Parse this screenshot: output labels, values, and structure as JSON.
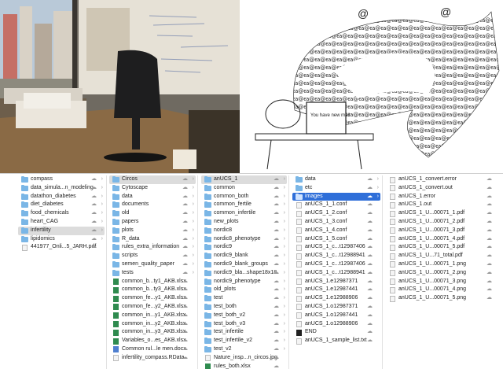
{
  "col1": [
    "compass",
    "data_simula...n_modeling",
    "datathon_diabetes",
    "diet_diabetes",
    "food_chemicals",
    "heart_CAG",
    "infertility",
    "lipidomics",
    "441977_Onli...5_JARH.pdf"
  ],
  "col2": [
    "Circos",
    "Cytoscape",
    "data",
    "documents",
    "old",
    "papers",
    "plots",
    "R_data",
    "rules_extra_information",
    "scripts",
    "semen_quality_paper",
    "tests",
    "common_b...ty1_AKB.xlsx",
    "common_b...ty3_AKB.xlsx",
    "common_fe...y1_AKB.xlsx",
    "common_fe...y2_AKB.xlsx",
    "common_in...y1_AKB.xlsx",
    "common_in...y2_AKB.xlsx",
    "common_in...y3_AKB.xlsx",
    "Variables_o...es_AKB.xlsx",
    "Common rul...le men.docx",
    "infertility_compass.RData"
  ],
  "col3": [
    "anUCS_1",
    "common",
    "common_both",
    "common_fertile",
    "common_infertile",
    "new_plots",
    "nordic8",
    "nordic8_phenotype",
    "nordic9",
    "nordic9_blank",
    "nordic9_blank_groups",
    "nordic9_bla...shape18x18",
    "nordic9_phenotype",
    "old_plots",
    "test",
    "test_both",
    "test_both_v2",
    "test_both_v3",
    "test_infertile",
    "test_infertile_v2",
    "test_v2",
    "Nature_insp...n_circos.jpg",
    "rules_both.xlsx",
    "rules_fertile.xlsx"
  ],
  "col4": [
    "data",
    "etc",
    "images",
    "anUCS_1_1.conf",
    "anUCS_1_2.conf",
    "anUCS_1_3.conf",
    "anUCS_1_4.conf",
    "anUCS_1_5.conf",
    "anUCS_1_c...t12987406",
    "anUCS_1_c...t12988941",
    "anUCS_1_c...t12987406",
    "anUCS_1_c...t12988941",
    "anUCS_1.e12987371",
    "anUCS_1.e12987441",
    "anUCS_1.e12988906",
    "anUCS_1.o12987371",
    "anUCS_1.o12987441",
    "anUCS_1.o12988906",
    "END",
    "anUCS_1_sample_list.txt"
  ],
  "col5": [
    "anUCS_1_convert.error",
    "anUCS_1_convert.out",
    "anUCS_1.error",
    "anUCS_1.out",
    "anUCS_1_U...00071_1.pdf",
    "anUCS_1_U...00071_2.pdf",
    "anUCS_1_U...00071_3.pdf",
    "anUCS_1_U...00071_4.pdf",
    "anUCS_1_U...00071_5.pdf",
    "anUCS_1_U...71_total.pdf",
    "anUCS_1_U...00071_1.png",
    "anUCS_1_U...00071_2.png",
    "anUCS_1_U...00071_3.png",
    "anUCS_1_U...00071_4.png",
    "anUCS_1_U...00071_5.png"
  ],
  "cartoon_screen_text": "You have new mail",
  "colors": {
    "folder": "#7ab6e6",
    "selection_blue": "#2f6fd9",
    "selection_gray": "#dcdcdc"
  }
}
